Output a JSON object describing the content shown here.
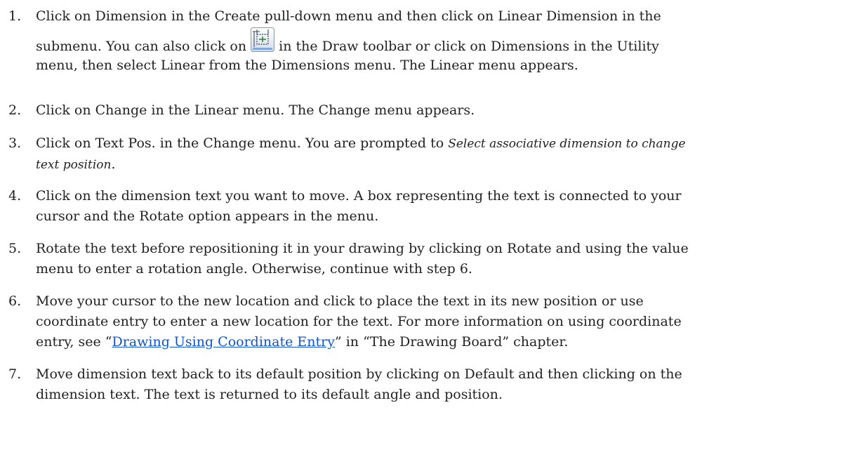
{
  "steps": [
    {
      "number": "1.",
      "line1": "Click on Dimension in the Create pull-down menu and then click on Linear Dimension in the",
      "line2_before_icon": "submenu. You can also click on",
      "icon": "linear-dimension-icon",
      "line2_after_icon": "in the Draw toolbar or click on Dimensions in the Utility",
      "line3": "menu, then select Linear from the Dimensions menu. The Linear menu appears."
    },
    {
      "number": "2.",
      "line1": "Click on Change in the Linear menu. The Change menu appears."
    },
    {
      "number": "3.",
      "line1": "Click on Text Pos. in the Change menu. You are prompted to",
      "line1_italic": "Select associative dimension to change",
      "line2_italic": "text position",
      "line2_end": "."
    },
    {
      "number": "4.",
      "line1": "Click on the dimension text you want to move. A box representing the text is connected to your",
      "line2": "cursor and the Rotate option appears in the menu."
    },
    {
      "number": "5.",
      "line1": "Rotate the text before repositioning it in your drawing by clicking on Rotate and using the value",
      "line2": "menu to enter a rotation angle. Otherwise, continue with step 6."
    },
    {
      "number": "6.",
      "line1": "Move your cursor to the new location and click to place the text in its new position or use",
      "line2": "coordinate entry to enter a new location for the text. For more information on using coordinate",
      "line3_before_link": "entry, see “",
      "line3_link": "Drawing Using Coordinate Entry",
      "line3_after_link": "” in “The Drawing Board” chapter."
    },
    {
      "number": "7.",
      "line1": "Move dimension text back to its default position by clicking on Default and then clicking on the",
      "line2": "dimension text. The text is returned to its default angle and position."
    }
  ],
  "colors": {
    "text": "#222222",
    "link": "#1155cc",
    "icon_frame": "#6a7a8c",
    "icon_face": "#eef2f7",
    "icon_accent": "#2f8a3a"
  }
}
